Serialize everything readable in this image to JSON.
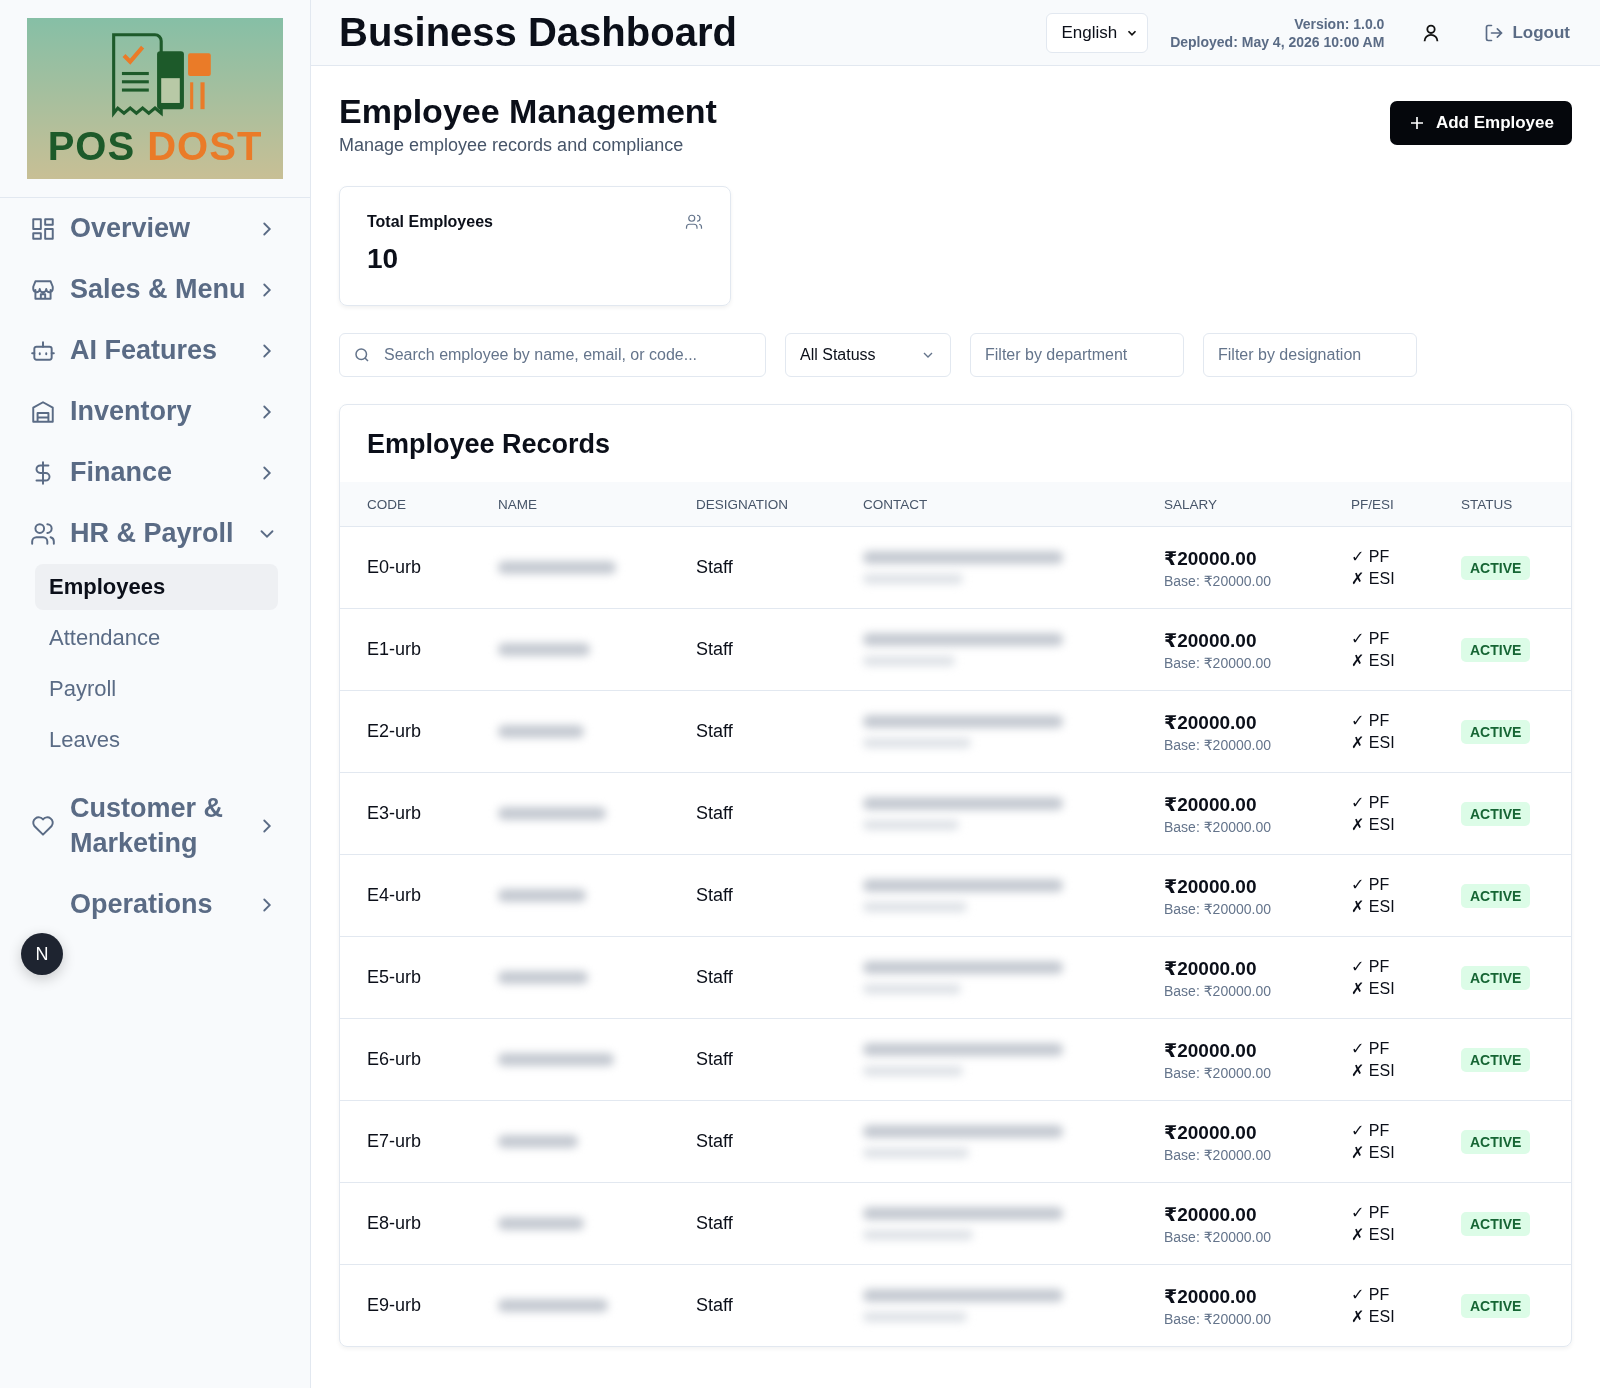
{
  "logo": {
    "word_1": "POS",
    "word_2": "DOST"
  },
  "sidebar": {
    "items": [
      {
        "label": "Overview",
        "expanded": false
      },
      {
        "label": "Sales & Menu",
        "expanded": false
      },
      {
        "label": "AI Features",
        "expanded": false
      },
      {
        "label": "Inventory",
        "expanded": false
      },
      {
        "label": "Finance",
        "expanded": false
      },
      {
        "label": "HR & Payroll",
        "expanded": true,
        "children": [
          {
            "label": "Employees",
            "selected": true
          },
          {
            "label": "Attendance",
            "selected": false
          },
          {
            "label": "Payroll",
            "selected": false
          },
          {
            "label": "Leaves",
            "selected": false
          }
        ]
      },
      {
        "label": "Customer & Marketing",
        "expanded": false
      },
      {
        "label": "Operations",
        "expanded": false
      }
    ]
  },
  "dev_badge": {
    "label": "N"
  },
  "header": {
    "title": "Business Dashboard",
    "language": "English",
    "version": "Version: 1.0.0",
    "deployed": "Deployed: May 4, 2026 10:00 AM",
    "logout": "Logout"
  },
  "page": {
    "title": "Employee Management",
    "subtitle": "Manage employee records and compliance",
    "add_button": "Add Employee"
  },
  "stat_card": {
    "label": "Total Employees",
    "value": "10"
  },
  "filters": {
    "search": {
      "placeholder": "Search employee by name, email, or code..."
    },
    "status": "All Statuss",
    "department": {
      "placeholder": "Filter by department"
    },
    "designation": {
      "placeholder": "Filter by designation"
    }
  },
  "table": {
    "title": "Employee Records",
    "columns": [
      "CODE",
      "NAME",
      "DESIGNATION",
      "CONTACT",
      "SALARY",
      "PF/ESI",
      "STATUS"
    ],
    "rows": [
      {
        "code": "E0-urb",
        "designation": "Staff",
        "salary": "₹20000.00",
        "base": "Base: ₹20000.00",
        "pf": "✓ PF",
        "esi": "✗ ESI",
        "status": "ACTIVE"
      },
      {
        "code": "E1-urb",
        "designation": "Staff",
        "salary": "₹20000.00",
        "base": "Base: ₹20000.00",
        "pf": "✓ PF",
        "esi": "✗ ESI",
        "status": "ACTIVE"
      },
      {
        "code": "E2-urb",
        "designation": "Staff",
        "salary": "₹20000.00",
        "base": "Base: ₹20000.00",
        "pf": "✓ PF",
        "esi": "✗ ESI",
        "status": "ACTIVE"
      },
      {
        "code": "E3-urb",
        "designation": "Staff",
        "salary": "₹20000.00",
        "base": "Base: ₹20000.00",
        "pf": "✓ PF",
        "esi": "✗ ESI",
        "status": "ACTIVE"
      },
      {
        "code": "E4-urb",
        "designation": "Staff",
        "salary": "₹20000.00",
        "base": "Base: ₹20000.00",
        "pf": "✓ PF",
        "esi": "✗ ESI",
        "status": "ACTIVE"
      },
      {
        "code": "E5-urb",
        "designation": "Staff",
        "salary": "₹20000.00",
        "base": "Base: ₹20000.00",
        "pf": "✓ PF",
        "esi": "✗ ESI",
        "status": "ACTIVE"
      },
      {
        "code": "E6-urb",
        "designation": "Staff",
        "salary": "₹20000.00",
        "base": "Base: ₹20000.00",
        "pf": "✓ PF",
        "esi": "✗ ESI",
        "status": "ACTIVE"
      },
      {
        "code": "E7-urb",
        "designation": "Staff",
        "salary": "₹20000.00",
        "base": "Base: ₹20000.00",
        "pf": "✓ PF",
        "esi": "✗ ESI",
        "status": "ACTIVE"
      },
      {
        "code": "E8-urb",
        "designation": "Staff",
        "salary": "₹20000.00",
        "base": "Base: ₹20000.00",
        "pf": "✓ PF",
        "esi": "✗ ESI",
        "status": "ACTIVE"
      },
      {
        "code": "E9-urb",
        "designation": "Staff",
        "salary": "₹20000.00",
        "base": "Base: ₹20000.00",
        "pf": "✓ PF",
        "esi": "✗ ESI",
        "status": "ACTIVE"
      }
    ]
  }
}
